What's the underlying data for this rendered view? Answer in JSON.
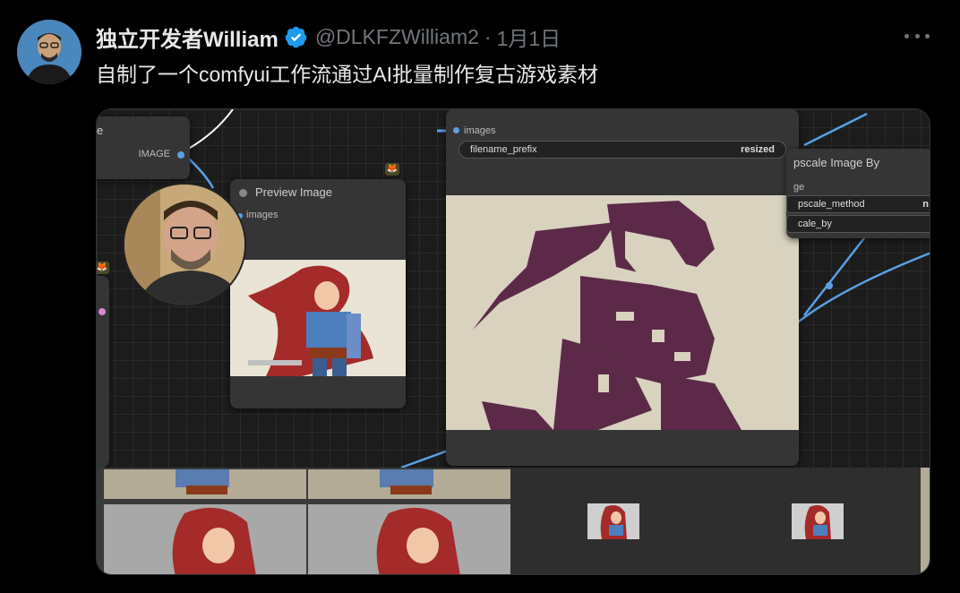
{
  "tweet": {
    "display_name": "独立开发者William",
    "handle": "@DLKFZWilliam2",
    "separator": "·",
    "date": "1月1日",
    "text": "自制了一个comfyui工作流通过AI批量制作复古游戏素材"
  },
  "media": {
    "load_node": {
      "title": "e",
      "output_label": "IMAGE"
    },
    "preview_node": {
      "title": "Preview Image",
      "input_label": "images"
    },
    "save_node": {
      "input_label": "images",
      "widget_name": "filename_prefix",
      "widget_value": "resized"
    },
    "upscale_node": {
      "title": "pscale Image By",
      "row1": "ge",
      "row2": "pscale_method",
      "row2_value": "n",
      "row3": "cale_by"
    }
  },
  "colors": {
    "accent_blue": "#1d9bf0",
    "link_wire": "#5aa0e6",
    "pixel_dark": "#5c2a48",
    "pixel_bg": "#d8d2bf"
  }
}
